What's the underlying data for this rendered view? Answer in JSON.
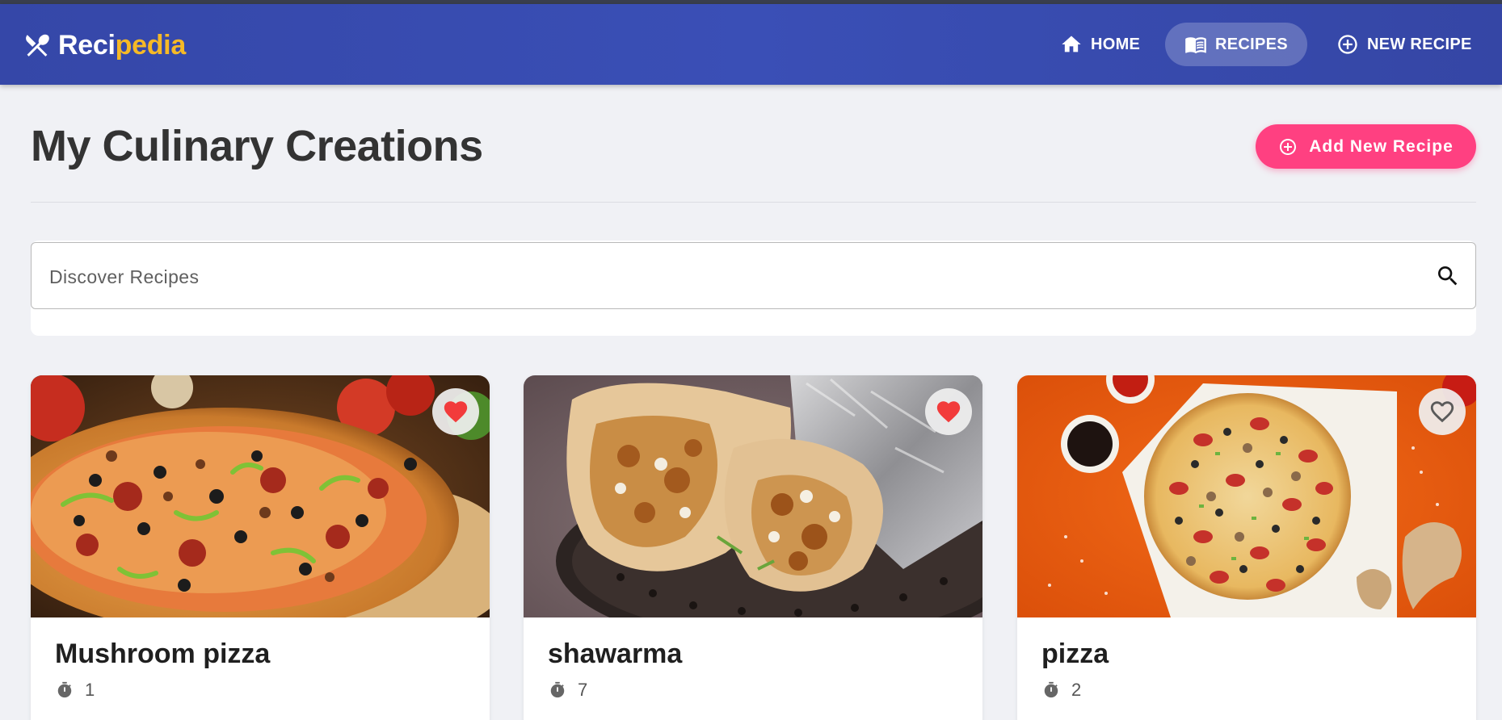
{
  "app": {
    "brand_part1": "Reci",
    "brand_part2": "pedia",
    "brand_color_secondary": "#f6b926",
    "navbar_color": "#3a4fb6"
  },
  "nav": {
    "items": [
      {
        "label": "HOME",
        "icon": "home-icon",
        "active": false
      },
      {
        "label": "RECIPES",
        "icon": "menu-book-icon",
        "active": true
      },
      {
        "label": "NEW RECIPE",
        "icon": "add-circle-icon",
        "active": false
      }
    ]
  },
  "main": {
    "title": "My Culinary Creations",
    "add_button_label": "Add New Recipe",
    "add_button_color": "#ff4081"
  },
  "search": {
    "placeholder": "Discover Recipes",
    "value": ""
  },
  "recipes": [
    {
      "title": "Mushroom pizza",
      "time": "1",
      "favorite": true,
      "image": "pizza-with-toppings-photo"
    },
    {
      "title": "shawarma",
      "time": "7",
      "favorite": true,
      "image": "shawarma-wrap-photo"
    },
    {
      "title": "pizza",
      "time": "2",
      "favorite": false,
      "image": "pizza-on-orange-background-photo"
    }
  ]
}
